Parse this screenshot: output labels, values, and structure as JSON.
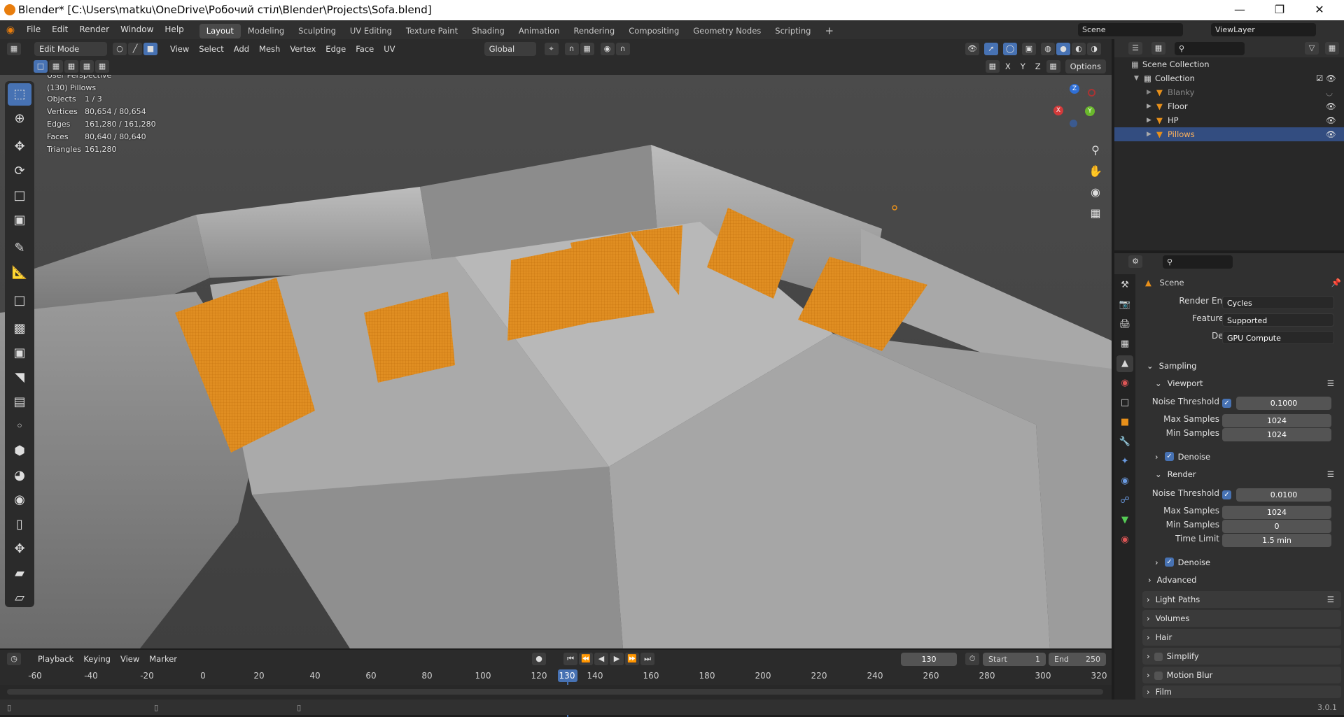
{
  "window": {
    "title": "Blender* [C:\\Users\\matku\\OneDrive\\Робочий стіл\\Blender\\Projects\\Sofa.blend]"
  },
  "menu": [
    "File",
    "Edit",
    "Render",
    "Window",
    "Help"
  ],
  "workspaces": [
    "Layout",
    "Modeling",
    "Sculpting",
    "UV Editing",
    "Texture Paint",
    "Shading",
    "Animation",
    "Rendering",
    "Compositing",
    "Geometry Nodes",
    "Scripting"
  ],
  "active_workspace": "Layout",
  "scene_field": "Scene",
  "viewlayer_field": "ViewLayer",
  "viewport_header": {
    "mode": "Edit Mode",
    "menus": [
      "View",
      "Select",
      "Add",
      "Mesh",
      "Vertex",
      "Edge",
      "Face",
      "UV"
    ],
    "orientation": "Global",
    "axes": [
      "X",
      "Y",
      "Z"
    ],
    "options": "Options"
  },
  "viewport_overlay": {
    "view_name": "User Perspective",
    "object_name": "(130) Pillows",
    "stats": [
      {
        "label": "Objects",
        "value": "1 / 3"
      },
      {
        "label": "Vertices",
        "value": "80,654 / 80,654"
      },
      {
        "label": "Edges",
        "value": "161,280 / 161,280"
      },
      {
        "label": "Faces",
        "value": "80,640 / 80,640"
      },
      {
        "label": "Triangles",
        "value": "161,280"
      }
    ],
    "gizmo_axes": [
      "Z",
      "X",
      "Y"
    ]
  },
  "outliner": {
    "scene_collection": "Scene Collection",
    "collection": "Collection",
    "items": [
      {
        "name": "Blanky",
        "hidden": true
      },
      {
        "name": "Floor",
        "hidden": false
      },
      {
        "name": "HP",
        "hidden": false
      },
      {
        "name": "Pillows",
        "hidden": false,
        "selected": true
      }
    ]
  },
  "properties": {
    "context": "Scene",
    "render_engine": {
      "label": "Render Engine",
      "value": "Cycles"
    },
    "feature_set": {
      "label": "Feature Set",
      "value": "Supported"
    },
    "device": {
      "label": "Device",
      "value": "GPU Compute"
    },
    "sampling": "Sampling",
    "viewport": {
      "title": "Viewport",
      "noise_threshold_label": "Noise Threshold",
      "noise_threshold": "0.1000",
      "max_samples_label": "Max Samples",
      "max_samples": "1024",
      "min_samples_label": "Min Samples",
      "min_samples": "1024",
      "denoise": "Denoise"
    },
    "render": {
      "title": "Render",
      "noise_threshold_label": "Noise Threshold",
      "noise_threshold": "0.0100",
      "max_samples_label": "Max Samples",
      "max_samples": "1024",
      "min_samples_label": "Min Samples",
      "min_samples": "0",
      "time_limit_label": "Time Limit",
      "time_limit": "1.5 min",
      "denoise": "Denoise"
    },
    "advanced": "Advanced",
    "panels": [
      "Light Paths",
      "Volumes",
      "Hair",
      "Simplify",
      "Motion Blur",
      "Film"
    ]
  },
  "timeline": {
    "menus": [
      "Playback",
      "Keying",
      "View",
      "Marker"
    ],
    "current_frame": "130",
    "start_label": "Start",
    "start": "1",
    "end_label": "End",
    "end": "250",
    "ticks": [
      "-60",
      "-40",
      "-20",
      "0",
      "20",
      "40",
      "60",
      "80",
      "100",
      "120",
      "130",
      "140",
      "160",
      "180",
      "200",
      "220",
      "240",
      "260",
      "280",
      "300",
      "320"
    ]
  },
  "statusbar": {
    "version": "3.0.1"
  },
  "colors": {
    "accent": "#4772b3",
    "selection": "#e8901a",
    "header": "#303030"
  }
}
